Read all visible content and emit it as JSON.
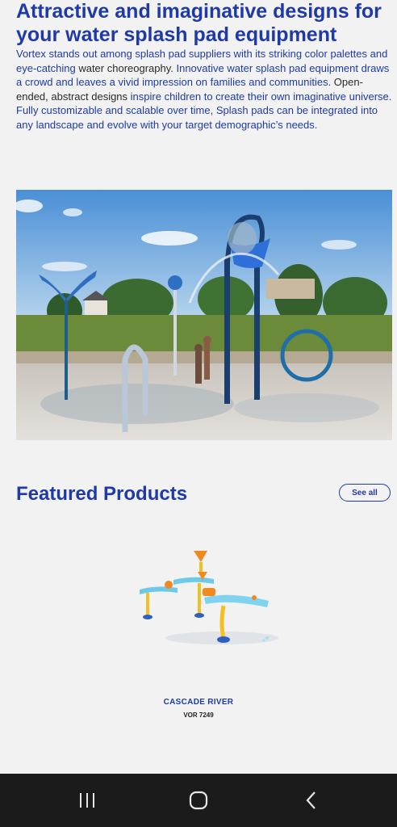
{
  "content": {
    "headline": "Attractive and imaginative designs for your water splash pad equipment",
    "intro": {
      "part1": "Vortex stands out among splash pad suppliers with its striking color palettes and eye-catching ",
      "part2": "water choreography",
      "part3": ". Innovative water splash pad equipment draws a crowd and leaves a vivid impression on families and communities. ",
      "part4": "Open-ended, abstract designs",
      "part5": " inspire children to create their own imaginative universe. Fully customizable and scalable over time, Splash pads can be integrated into any landscape and evolve with your target demographic’s needs."
    }
  },
  "featured": {
    "title": "Featured Products",
    "see_all": "See all",
    "products": [
      {
        "name": "CASCADE RIVER",
        "code": "VOR 7249"
      }
    ]
  },
  "system_nav": {
    "icons": [
      "recent-apps-icon",
      "home-icon",
      "back-icon"
    ]
  },
  "colors": {
    "accent": "#1f3aa8",
    "background": "#f2f2f2",
    "nav_bar": "#1b1b1b"
  }
}
